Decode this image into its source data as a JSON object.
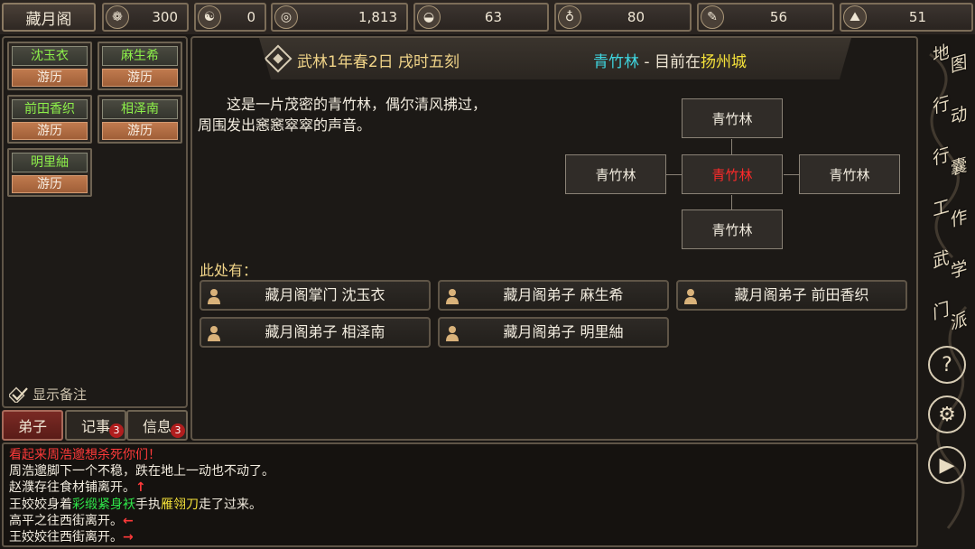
{
  "topbar": {
    "sect_name": "藏月阁",
    "resources": [
      {
        "icon": "swirl-coin-icon",
        "glyph": "❁",
        "value": "300"
      },
      {
        "icon": "yin-yang-icon",
        "glyph": "☯",
        "value": "0"
      },
      {
        "icon": "copper-coin-icon",
        "glyph": "◎",
        "value": "1,813"
      },
      {
        "icon": "rice-bowl-icon",
        "glyph": "◒",
        "value": "63"
      },
      {
        "icon": "gourd-icon",
        "glyph": "♁",
        "value": "80"
      },
      {
        "icon": "scroll-icon",
        "glyph": "✎",
        "value": "56"
      },
      {
        "icon": "rock-icon",
        "glyph": "⛰",
        "value": "51"
      }
    ]
  },
  "disciples": [
    {
      "name": "沈玉衣",
      "status": "游历"
    },
    {
      "name": "麻生希",
      "status": "游历"
    },
    {
      "name": "前田香织",
      "status": "游历"
    },
    {
      "name": "相泽南",
      "status": "游历"
    },
    {
      "name": "明里紬",
      "status": "游历"
    }
  ],
  "notes_toggle": "显示备注",
  "tabs": [
    {
      "label": "弟子",
      "badge": ""
    },
    {
      "label": "记事",
      "badge": "3"
    },
    {
      "label": "信息",
      "badge": "3"
    }
  ],
  "header": {
    "date": "武林1年春2日 戌时五刻",
    "place": "青竹林",
    "separator": " - ",
    "now_at": "目前在",
    "city": "扬州城"
  },
  "description": {
    "line1": "这是一片茂密的青竹林，偶尔清风拂过，",
    "line2": "周围发出窸窸窣窣的声音。"
  },
  "map": {
    "north": "青竹林",
    "west": "青竹林",
    "center": "青竹林",
    "east": "青竹林",
    "south": "青竹林"
  },
  "here_label": "此处有：",
  "npcs": [
    "藏月阁掌门 沈玉衣",
    "藏月阁弟子 麻生希",
    "藏月阁弟子 前田香织",
    "藏月阁弟子 相泽南",
    "藏月阁弟子 明里紬"
  ],
  "right_nav": [
    {
      "c1": "地",
      "c2": "图"
    },
    {
      "c1": "行",
      "c2": "动"
    },
    {
      "c1": "行",
      "c2": "囊"
    },
    {
      "c1": "工",
      "c2": "作"
    },
    {
      "c1": "武",
      "c2": "学"
    },
    {
      "c1": "门",
      "c2": "派"
    }
  ],
  "right_icons": {
    "help": "?",
    "settings": "⚙",
    "play": "▶"
  },
  "log": {
    "l1": "看起来周浩邈想杀死你们！",
    "l2": "周浩邈脚下一个不稳，跌在地上一动也不动了。",
    "l3": "赵濮存往食材铺离开。",
    "l3_arrow": "↑",
    "l4_a": "王姣姣身着",
    "l4_b": "彩缎紧身袄",
    "l4_c": "手执",
    "l4_d": "雁翎刀",
    "l4_e": "走了过来。",
    "l5": "高平之往西街离开。",
    "l5_arrow": "←",
    "l6": "王姣姣往西街离开。",
    "l6_arrow": "→"
  }
}
